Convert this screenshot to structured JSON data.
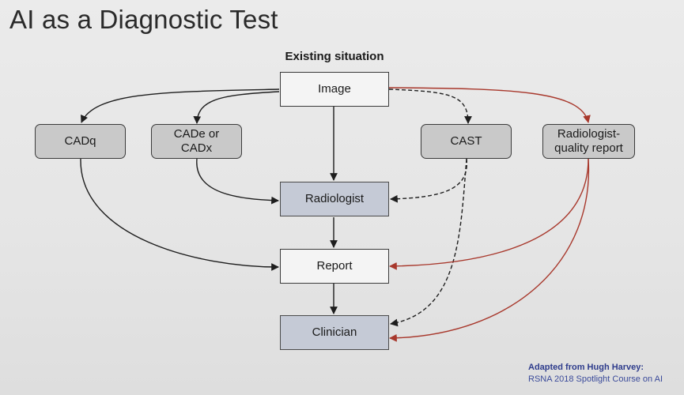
{
  "slide": {
    "title": "AI as a Diagnostic Test",
    "subtitle": "Existing situation",
    "credit": {
      "line1": "Adapted from Hugh Harvey:",
      "line2": "RSNA 2018 Spotlight Course on AI"
    }
  },
  "nodes": {
    "image": "Image",
    "cadq": "CADq",
    "cade_line1": "CADe or",
    "cade_line2": "CADx",
    "cast": "CAST",
    "rqr_line1": "Radiologist-",
    "rqr_line2": "quality report",
    "radiologist": "Radiologist",
    "report": "Report",
    "clinician": "Clinician"
  },
  "colors": {
    "black_edge": "#1e1e1e",
    "red_edge": "#a8382c",
    "box_gray": "#c9c9c9",
    "box_blue": "#c5cad6"
  },
  "edges": [
    {
      "from": "image",
      "to": "cadq",
      "style": "solid",
      "color": "black"
    },
    {
      "from": "image",
      "to": "cade-cadx",
      "style": "solid",
      "color": "black"
    },
    {
      "from": "image",
      "to": "radiologist",
      "style": "solid",
      "color": "black"
    },
    {
      "from": "image",
      "to": "cast",
      "style": "dashed",
      "color": "black"
    },
    {
      "from": "image",
      "to": "radiologist-quality-report",
      "style": "solid",
      "color": "red"
    },
    {
      "from": "cade-cadx",
      "to": "radiologist",
      "style": "solid",
      "color": "black"
    },
    {
      "from": "cadq",
      "to": "report",
      "style": "solid",
      "color": "black"
    },
    {
      "from": "cast",
      "to": "radiologist",
      "style": "dashed",
      "color": "black"
    },
    {
      "from": "cast",
      "to": "clinician",
      "style": "dashed",
      "color": "black"
    },
    {
      "from": "radiologist",
      "to": "report",
      "style": "solid",
      "color": "black"
    },
    {
      "from": "report",
      "to": "clinician",
      "style": "solid",
      "color": "black"
    },
    {
      "from": "radiologist-quality-report",
      "to": "report",
      "style": "solid",
      "color": "red"
    },
    {
      "from": "radiologist-quality-report",
      "to": "clinician",
      "style": "solid",
      "color": "red"
    }
  ]
}
